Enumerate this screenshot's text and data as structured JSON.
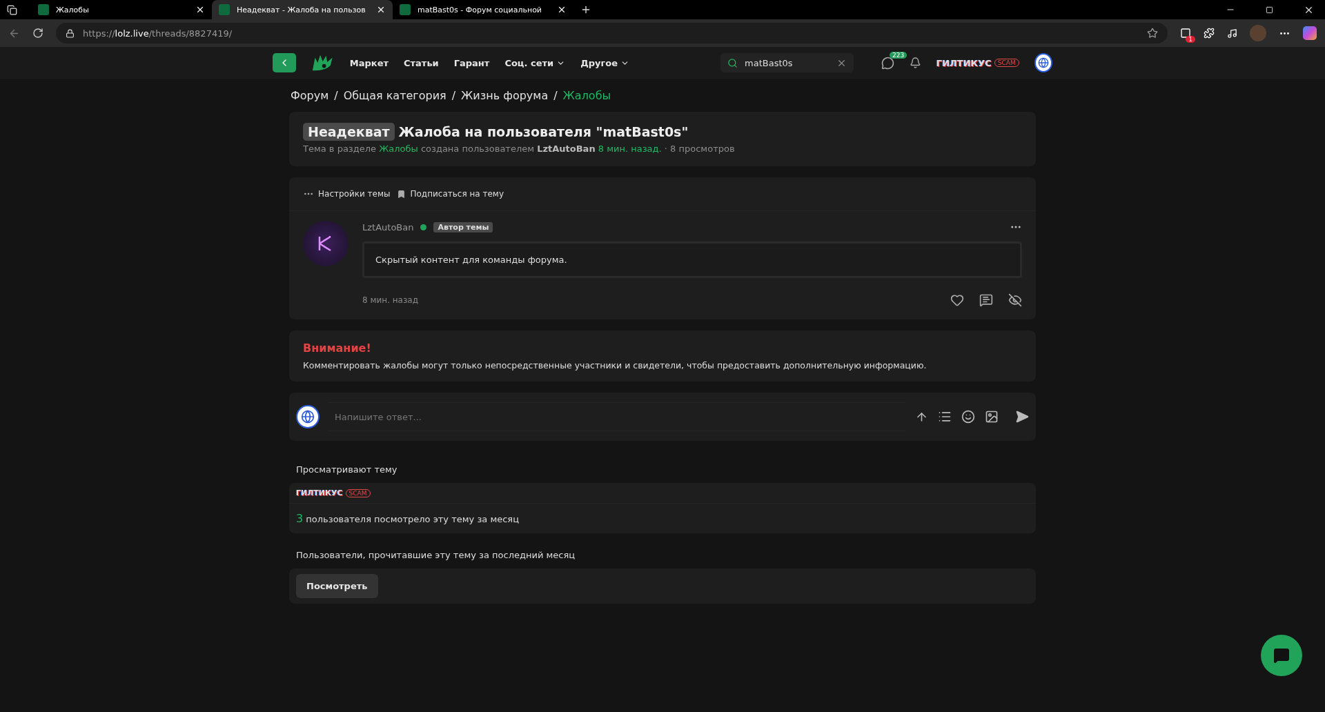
{
  "browser": {
    "tabs": [
      {
        "title": "Жалобы",
        "selected": false
      },
      {
        "title": "Неадекват - Жалоба на пользов",
        "selected": true
      },
      {
        "title": "matBast0s - Форум социальной",
        "selected": false
      }
    ],
    "url": {
      "scheme": "https://",
      "host": "lolz.live",
      "path": "/threads/8827419/"
    },
    "extension_badge": "1"
  },
  "header": {
    "nav": [
      {
        "label": "Маркет",
        "dropdown": false
      },
      {
        "label": "Статьи",
        "dropdown": false
      },
      {
        "label": "Гарант",
        "dropdown": false
      },
      {
        "label": "Соц. сети",
        "dropdown": true
      },
      {
        "label": "Другое",
        "dropdown": true
      }
    ],
    "search": {
      "value": "matBast0s"
    },
    "messages_badge": "223",
    "username": "ГИЛТИКУС",
    "user_badge": "SCAM"
  },
  "breadcrumbs": [
    {
      "label": "Форум",
      "current": false
    },
    {
      "separator": "/",
      "label": "Общая категория",
      "current": false
    },
    {
      "separator": "/",
      "label": "Жизнь форума",
      "current": false
    },
    {
      "separator": "/",
      "label": "Жалобы",
      "current": true
    }
  ],
  "thread": {
    "prefix": "Неадекват",
    "title": "Жалоба на пользователя \"matBast0s\"",
    "meta": [
      {
        "kind": "text",
        "text": "Тема в разделе"
      },
      {
        "kind": "link",
        "text": "Жалобы"
      },
      {
        "kind": "text",
        "text": "создана пользователем"
      },
      {
        "kind": "author",
        "text": "LztAutoBan"
      },
      {
        "kind": "link",
        "text": "8 мин. назад."
      },
      {
        "kind": "dot",
        "text": "·"
      },
      {
        "kind": "text",
        "text": "8 просмотров"
      }
    ]
  },
  "toolbar": [
    "Настройки темы",
    "Подписаться на тему"
  ],
  "post": {
    "author": "LztAutoBan",
    "online": true,
    "author_badge": "Автор темы",
    "content": "Скрытый контент для команды форума.",
    "time": "8 мин. назад"
  },
  "warning": {
    "title": "Внимание!",
    "text": "Комментировать жалобы могут только непосредственные участники и свидетели, чтобы предоставить дополнительную информацию."
  },
  "reply": {
    "placeholder": "Напишите ответ..."
  },
  "viewing": {
    "title": "Просматривают тему",
    "users": [
      {
        "name": "ГИЛТИКУС",
        "badge": "SCAM"
      }
    ],
    "count": "3",
    "count_text": "пользователя посмотрело эту тему за месяц"
  },
  "readers": {
    "title": "Пользователи, прочитавшие эту тему за последний месяц",
    "button": "Посмотреть"
  }
}
